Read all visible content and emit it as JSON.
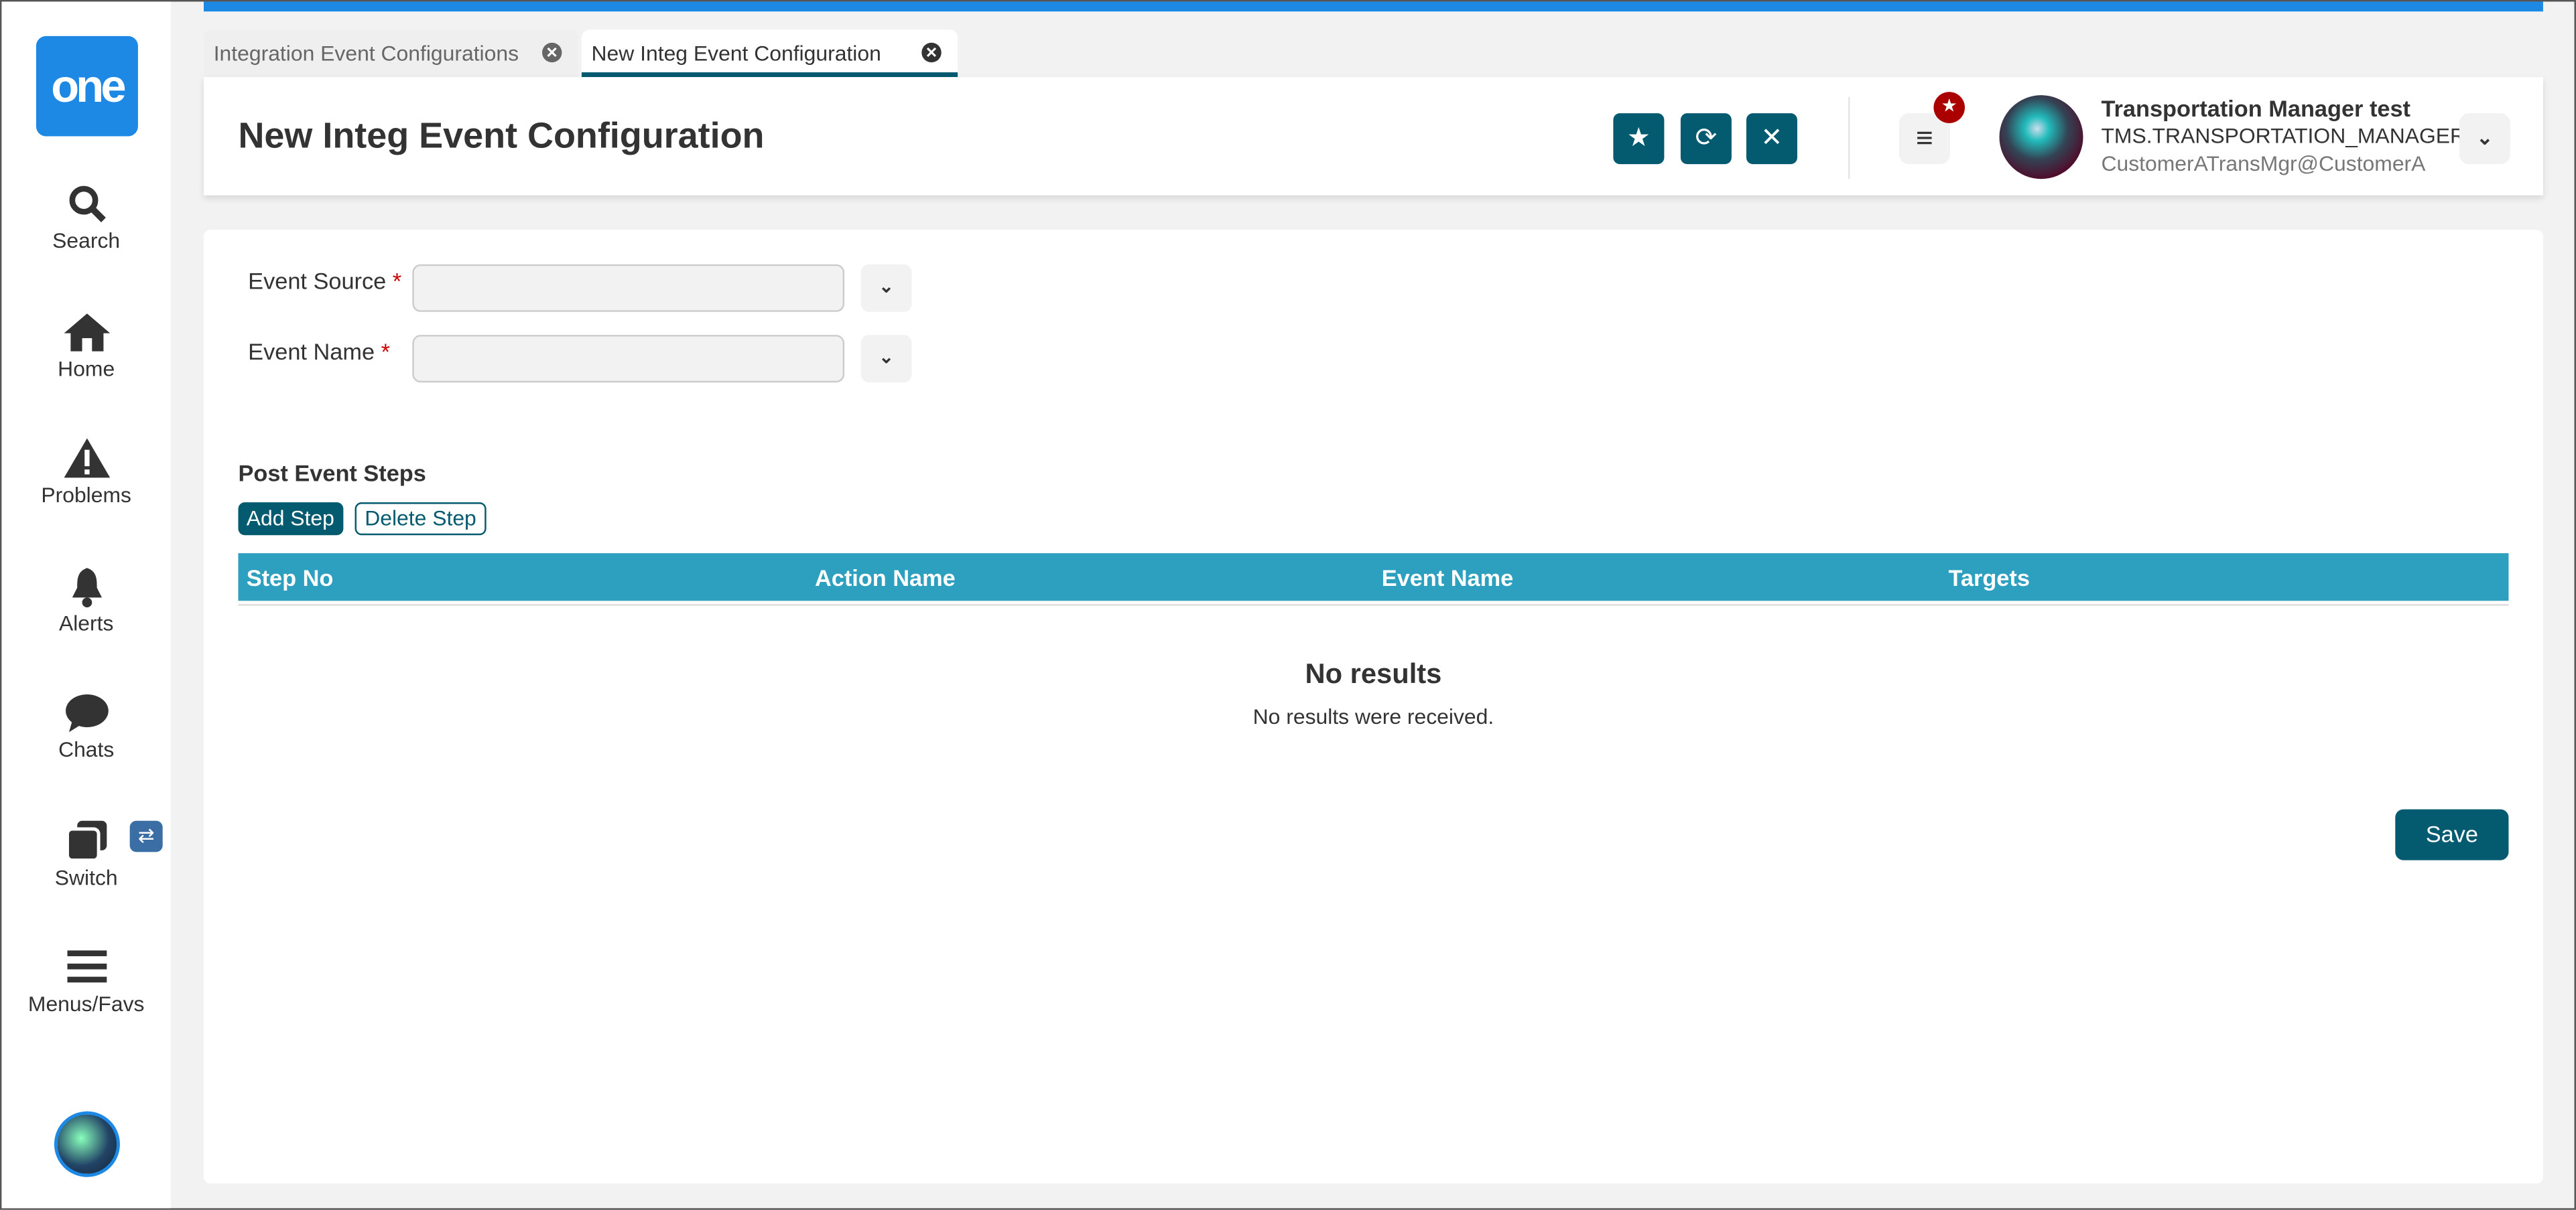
{
  "sidebar": {
    "logo": "one",
    "items": [
      {
        "label": "Search"
      },
      {
        "label": "Home"
      },
      {
        "label": "Problems"
      },
      {
        "label": "Alerts"
      },
      {
        "label": "Chats"
      },
      {
        "label": "Switch"
      },
      {
        "label": "Menus/Favs"
      }
    ]
  },
  "tabs": [
    {
      "label": "Integration Event Configurations"
    },
    {
      "label": "New Integ Event Configuration"
    }
  ],
  "header": {
    "title": "New Integ Event Configuration"
  },
  "user": {
    "name": "Transportation Manager test",
    "role": "TMS.TRANSPORTATION_MANAGER",
    "email": "CustomerATransMgr@CustomerA"
  },
  "form": {
    "event_source_label": "Event Source",
    "event_name_label": "Event Name",
    "required_mark": "*",
    "event_source_value": "",
    "event_name_value": ""
  },
  "steps": {
    "title": "Post Event Steps",
    "add_label": "Add Step",
    "delete_label": "Delete Step",
    "columns": [
      "Step No",
      "Action Name",
      "Event Name",
      "Targets"
    ],
    "empty_title": "No results",
    "empty_text": "No results were received."
  },
  "save_label": "Save",
  "colors": {
    "accent": "#045a6e",
    "table_header": "#2ea0bf",
    "top_bar": "#1e88e5"
  }
}
